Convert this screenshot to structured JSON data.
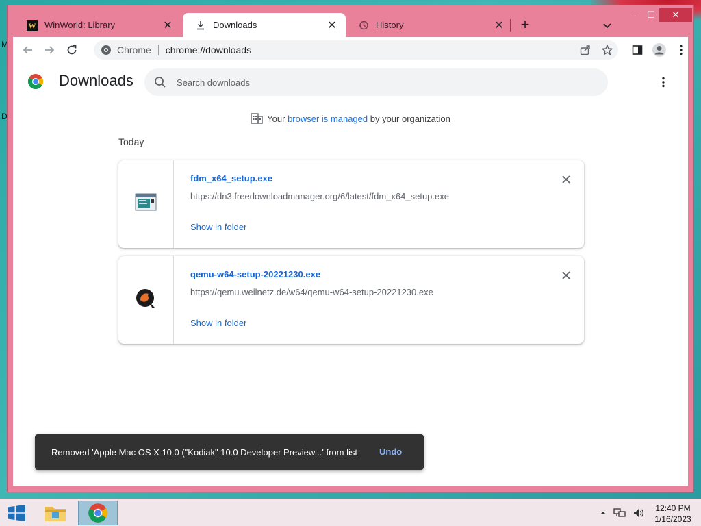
{
  "desktop": {
    "edge_text_1": "M",
    "edge_text_2": "D"
  },
  "window": {
    "tabs": [
      {
        "title": "WinWorld: Library",
        "icon": "winworld-logo-icon"
      },
      {
        "title": "Downloads",
        "icon": "download-icon"
      },
      {
        "title": "History",
        "icon": "history-icon"
      }
    ],
    "controls": {
      "minimize": "–",
      "maximize": "☐",
      "close": "✕"
    }
  },
  "toolbar": {
    "site_label": "Chrome",
    "url": "chrome://downloads"
  },
  "page": {
    "title": "Downloads",
    "search_placeholder": "Search downloads",
    "managed": {
      "prefix": "Your ",
      "link": "browser is managed",
      "suffix": " by your organization"
    },
    "section_date": "Today",
    "downloads": [
      {
        "filename": "fdm_x64_setup.exe",
        "url": "https://dn3.freedownloadmanager.org/6/latest/fdm_x64_setup.exe",
        "action": "Show in folder",
        "icon": "executable-file-icon"
      },
      {
        "filename": "qemu-w64-setup-20221230.exe",
        "url": "https://qemu.weilnetz.de/w64/qemu-w64-setup-20221230.exe",
        "action": "Show in folder",
        "icon": "qemu-app-icon"
      }
    ]
  },
  "toast": {
    "message": "Removed 'Apple Mac OS X 10.0 (\"Kodiak\" 10.0 Developer Preview...' from list",
    "action": "Undo"
  },
  "taskbar": {
    "time": "12:40 PM",
    "date": "1/16/2023"
  },
  "colors": {
    "frame": "#e9819b",
    "accent_blue": "#1967d2",
    "toast_bg": "#323232",
    "taskbar_bg": "#f1e6ea"
  }
}
